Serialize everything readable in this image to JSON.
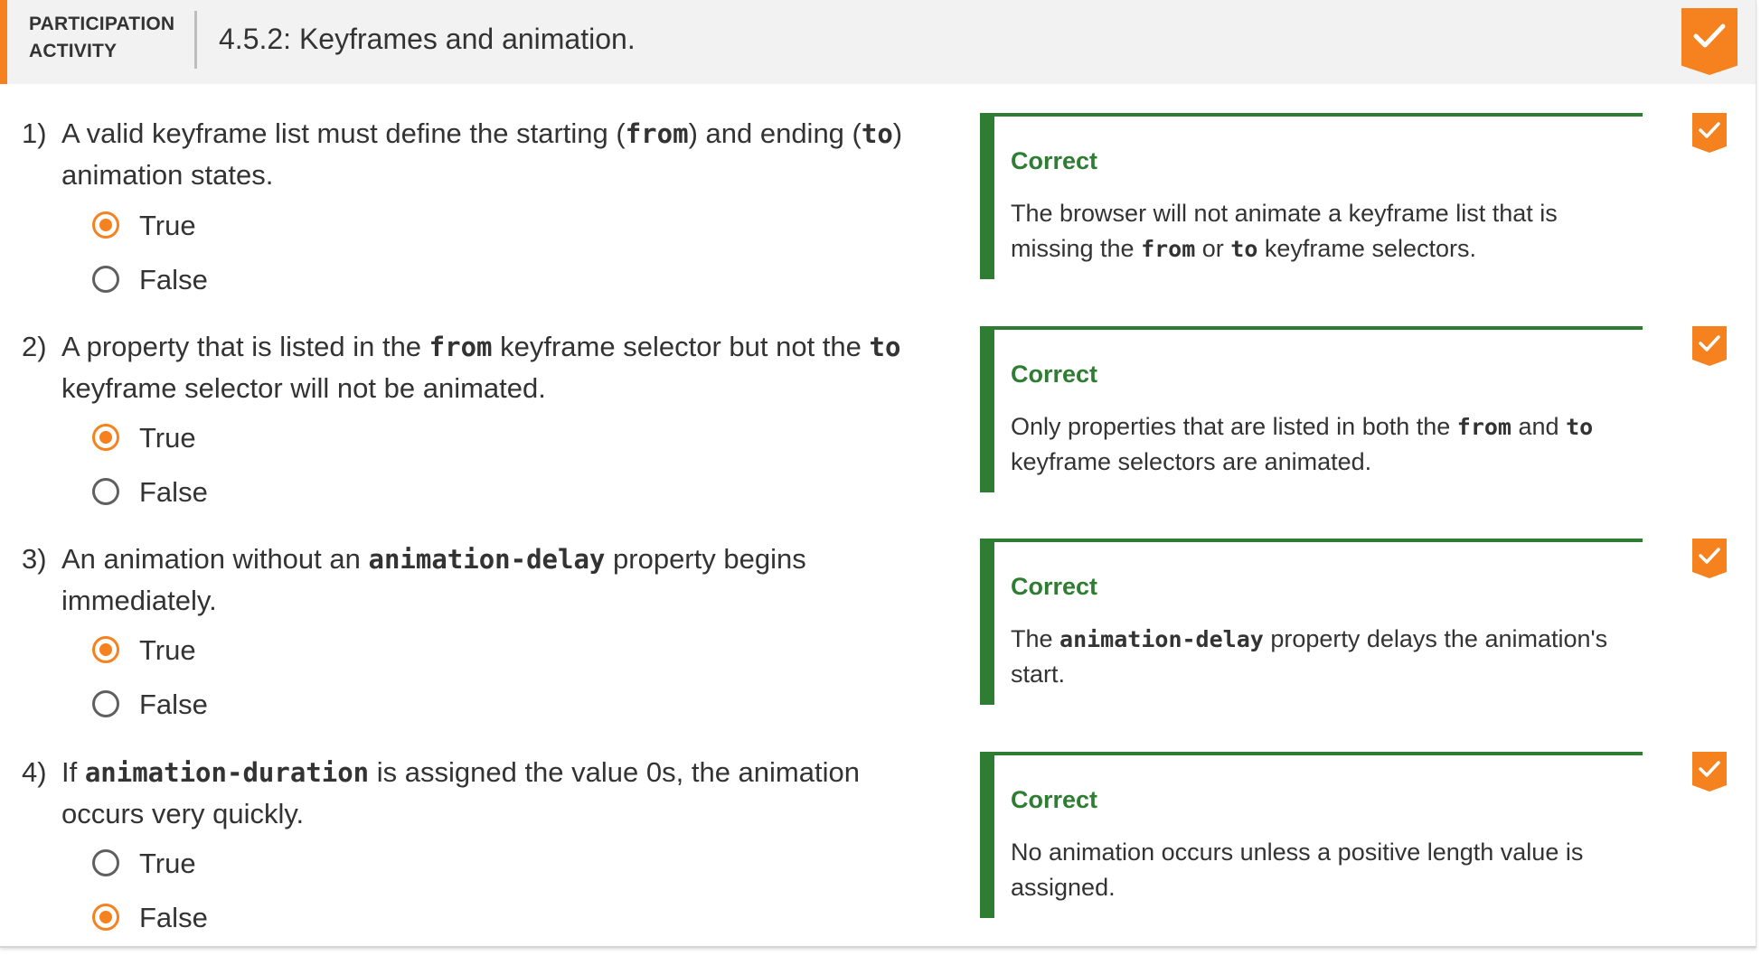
{
  "header": {
    "activity_type_line1": "PARTICIPATION",
    "activity_type_line2": "ACTIVITY",
    "title": "4.5.2: Keyframes and animation.",
    "completion_icon": "checkmark-icon",
    "accent_color": "#f5811f"
  },
  "questions": [
    {
      "number": "1)",
      "text_parts": [
        "A valid keyframe list must define the starting (",
        "from",
        ") and ending (",
        "to",
        ")",
        "animation states."
      ],
      "choices": [
        {
          "label": "True",
          "selected": true
        },
        {
          "label": "False",
          "selected": false
        }
      ],
      "feedback": {
        "status": "Correct",
        "text_parts": [
          "The browser will not animate a keyframe list that is",
          "missing the ",
          "from",
          " or ",
          "to",
          " keyframe selectors."
        ]
      }
    },
    {
      "number": "2)",
      "text_parts": [
        "A property that is listed in the ",
        "from",
        " keyframe selector but not the ",
        "to",
        "keyframe selector will not be animated."
      ],
      "choices": [
        {
          "label": "True",
          "selected": true
        },
        {
          "label": "False",
          "selected": false
        }
      ],
      "feedback": {
        "status": "Correct",
        "text_parts": [
          "Only properties that are listed in both the ",
          "from",
          " and ",
          "to",
          "keyframe selectors are animated."
        ]
      }
    },
    {
      "number": "3)",
      "text_parts": [
        "An animation without an ",
        "animation-delay",
        " property begins",
        "immediately."
      ],
      "choices": [
        {
          "label": "True",
          "selected": true
        },
        {
          "label": "False",
          "selected": false
        }
      ],
      "feedback": {
        "status": "Correct",
        "text_parts": [
          "The ",
          "animation-delay",
          " property delays the animation's",
          "start."
        ]
      }
    },
    {
      "number": "4)",
      "text_parts": [
        "If ",
        "animation-duration",
        " is assigned the value 0s, the animation",
        "occurs very quickly."
      ],
      "choices": [
        {
          "label": "True",
          "selected": false
        },
        {
          "label": "False",
          "selected": true
        }
      ],
      "feedback": {
        "status": "Correct",
        "text_parts": [
          "No animation occurs unless a positive length value is",
          "assigned."
        ]
      }
    }
  ],
  "colors": {
    "correct_green": "#2e7d32",
    "accent_orange": "#f5811f"
  }
}
